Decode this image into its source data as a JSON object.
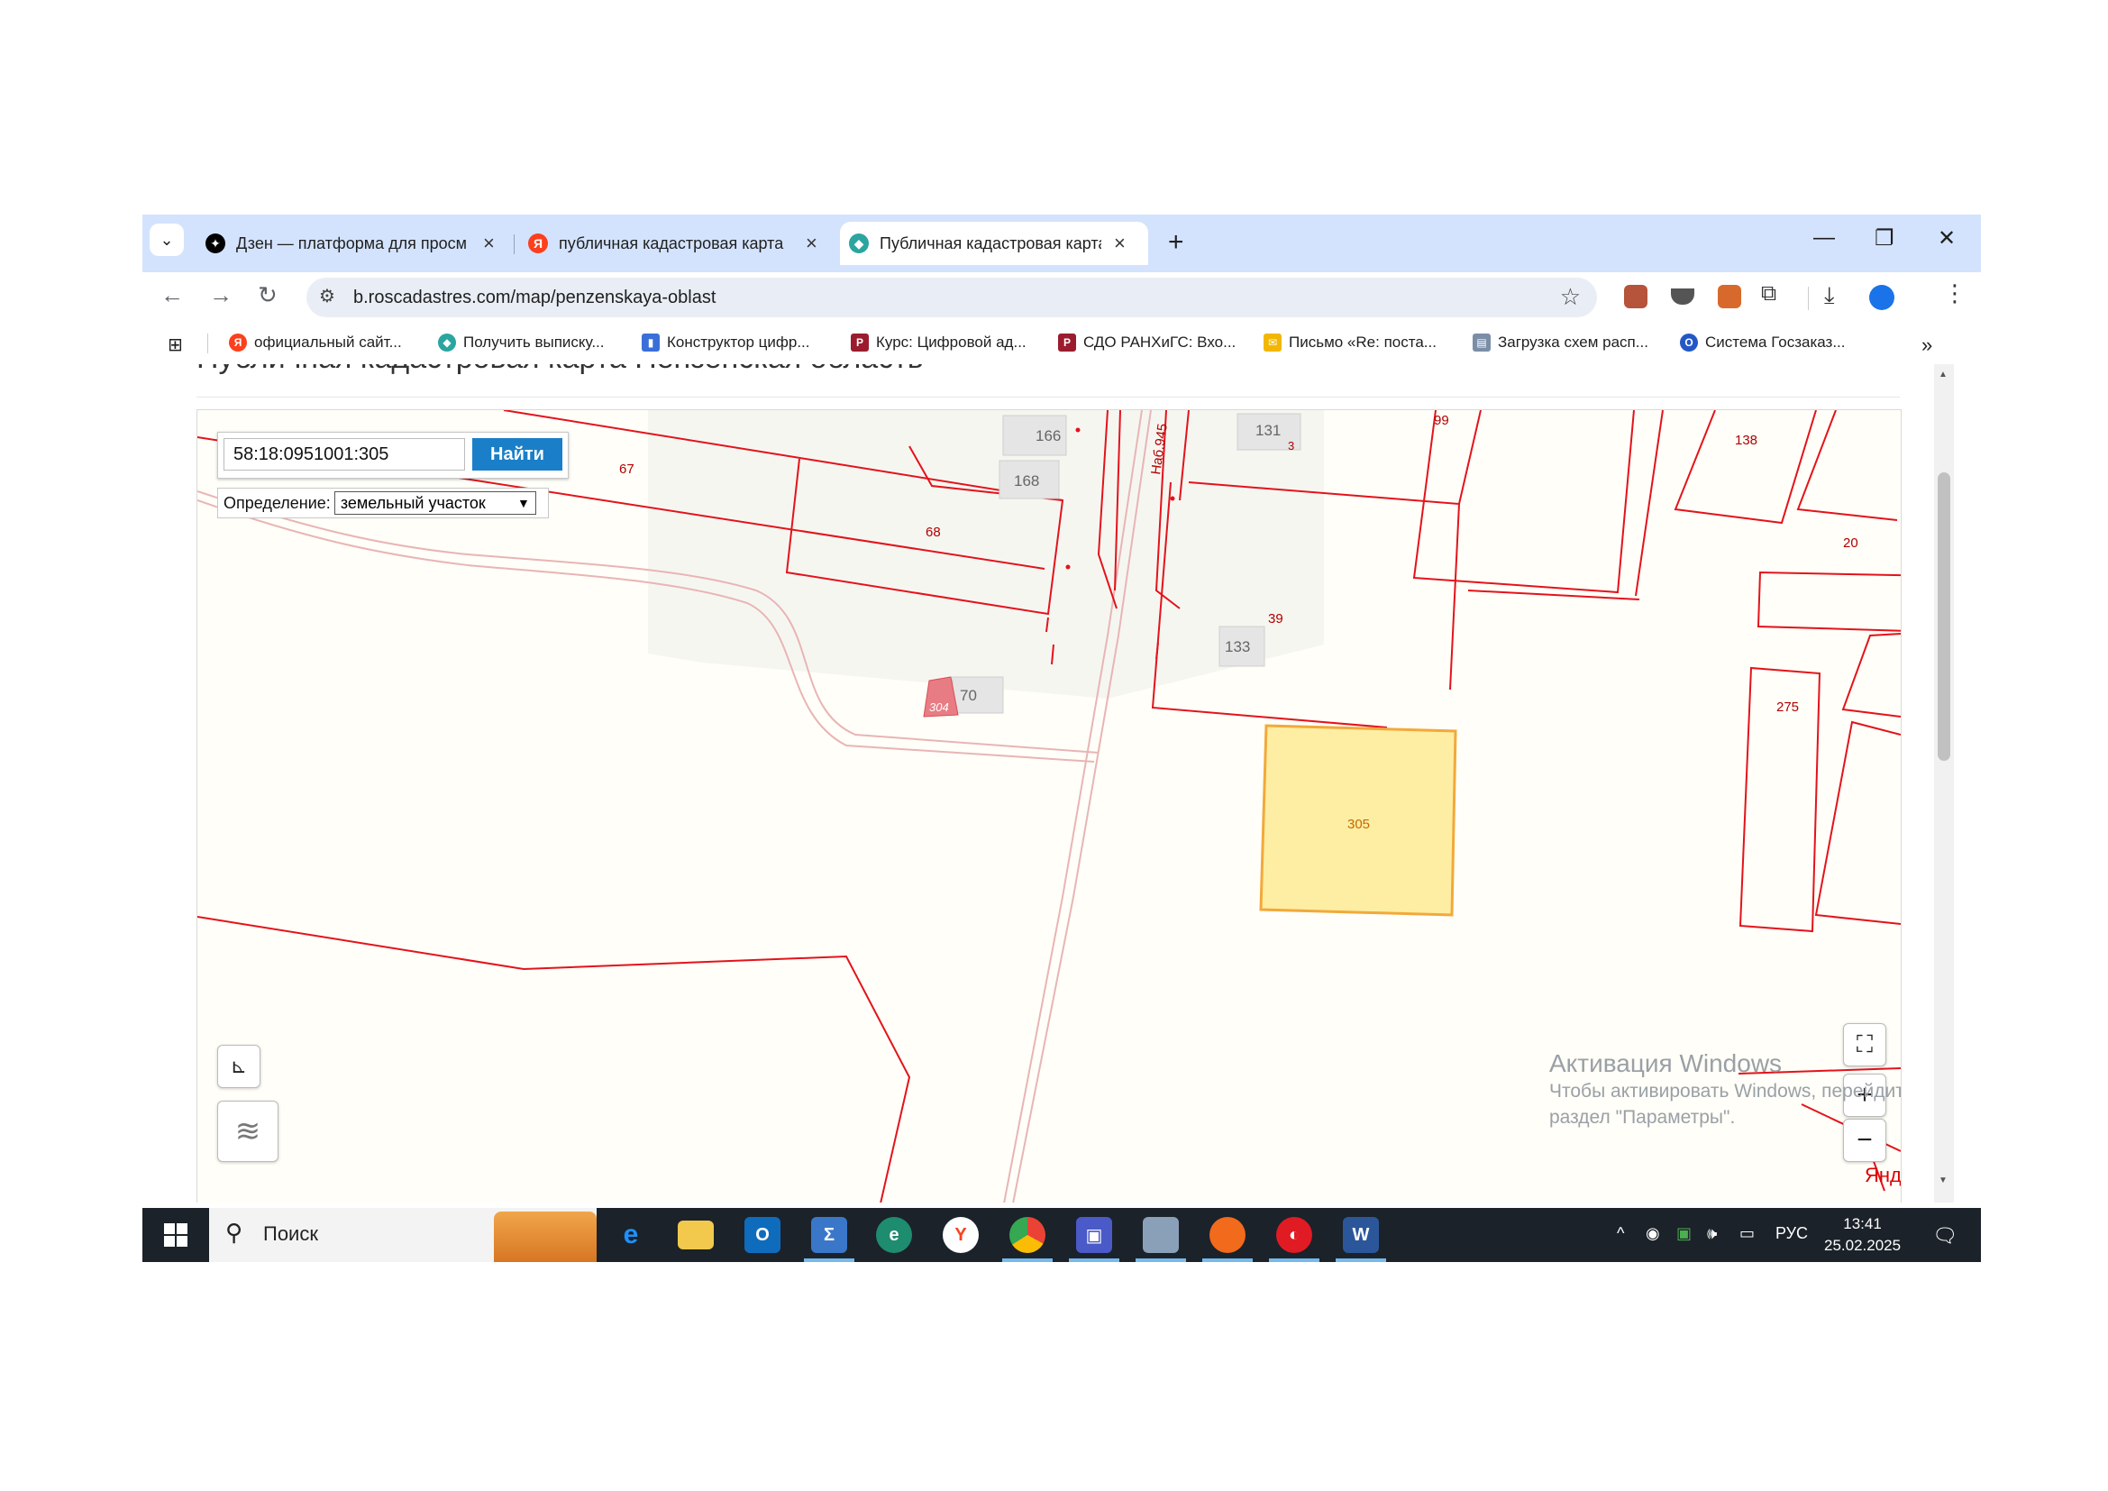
{
  "browser": {
    "tabs": [
      {
        "label": "Дзен — платформа для просм",
        "icon": "dzen-icon",
        "color": "#000000",
        "glyph": "✦",
        "active": false
      },
      {
        "label": "публичная кадастровая карта",
        "icon": "yandex-icon",
        "color": "#fc3f1d",
        "glyph": "Я",
        "active": false
      },
      {
        "label": "Публичная кадастровая карта",
        "icon": "roscadastre-icon",
        "color": "#2aa5a0",
        "glyph": "◆",
        "active": true
      }
    ],
    "new_tab": "+",
    "url": "b.roscadastres.com/map/penzenskaya-oblast",
    "bookmarks": [
      {
        "label": "официальный сайт...",
        "icon": "yandex-icon",
        "color": "#fc3f1d",
        "glyph": "Я"
      },
      {
        "label": "Получить выписку...",
        "icon": "pin-icon",
        "color": "#2aa5a0",
        "glyph": "◆"
      },
      {
        "label": "Конструктор цифр...",
        "icon": "doc-icon",
        "color": "#3a6fd8",
        "glyph": "▮"
      },
      {
        "label": "Курс: Цифровой ад...",
        "icon": "ranepa-icon",
        "color": "#9b1c2e",
        "glyph": "Р"
      },
      {
        "label": "СДО РАНХиГС: Вхо...",
        "icon": "ranepa-icon",
        "color": "#9b1c2e",
        "glyph": "Р"
      },
      {
        "label": "Письмо «Re: поста...",
        "icon": "mail-icon",
        "color": "#f2b705",
        "glyph": "✉"
      },
      {
        "label": "Загрузка схем расп...",
        "icon": "file-icon",
        "color": "#7a8ea8",
        "glyph": "▤"
      },
      {
        "label": "Система Госзаказ...",
        "icon": "goszakaz-icon",
        "color": "#2457c5",
        "glyph": "О"
      }
    ],
    "bookmarks_more": "»"
  },
  "page": {
    "title": "Публичная кадастровая карта Пензенская область"
  },
  "map": {
    "search_value": "58:18:0951001:305",
    "find_button": "Найти",
    "definition_label": "Определение:",
    "definition_value": "земельный участок",
    "parcel_labels": {
      "p67": "67",
      "p68": "68",
      "p99": "99",
      "p138": "138",
      "p20": "20",
      "p39": "39",
      "p275": "275",
      "p305": "305",
      "p3": "3",
      "p304": "304"
    },
    "building_labels": {
      "b166": "166",
      "b168": "168",
      "b131": "131",
      "b133": "133",
      "b70": "70"
    },
    "street_label": "Наб.945",
    "zoom_in": "+",
    "zoom_out": "−",
    "provider": "Яндекс",
    "colors": {
      "parcel_border": "#e3131b",
      "selected_fill": "#fdeea3",
      "selected_border": "#f2a93b",
      "building": "#e5e5e5",
      "road": "#e8b5b5"
    }
  },
  "watermark": {
    "title": "Активация Windows",
    "line1": "Чтобы активировать Windows, перейдите в",
    "line2": "раздел \"Параметры\"."
  },
  "taskbar": {
    "search_placeholder": "Поиск",
    "apps": [
      "ie-icon",
      "explorer-icon",
      "outlook-icon",
      "sum-icon",
      "edge-icon",
      "yandex-browser-icon",
      "chrome-icon",
      "save-icon",
      "game-icon",
      "firefox-icon",
      "media-icon",
      "word-icon"
    ],
    "lang": "РУС",
    "time": "13:41",
    "date": "25.02.2025"
  }
}
